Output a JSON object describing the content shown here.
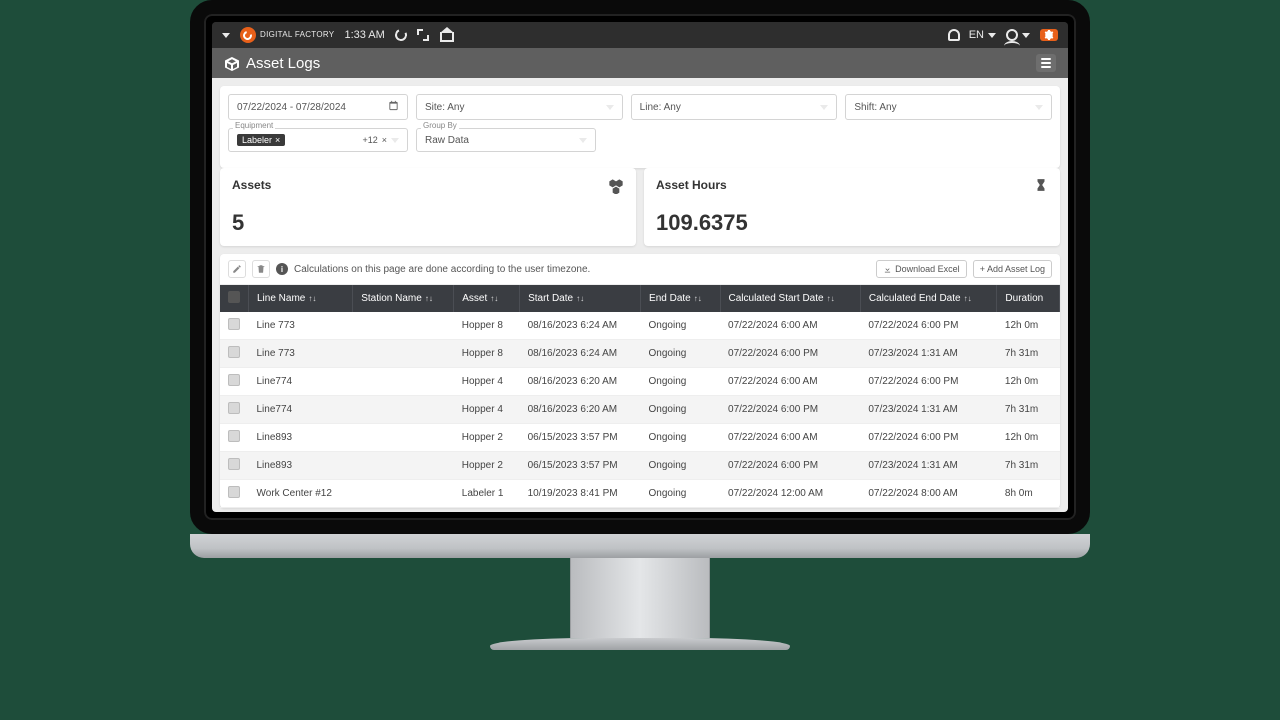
{
  "topbar": {
    "brand": "DIGITAL FACTORY",
    "time": "1:33 AM",
    "lang": "EN",
    "notif_badge": ""
  },
  "header": {
    "title": "Asset Logs"
  },
  "filters": {
    "date_range": "07/22/2024 - 07/28/2024",
    "site_label": "Site: Any",
    "line_label": "Line: Any",
    "shift_label": "Shift: Any",
    "equipment_label": "Equipment",
    "equipment_chip": "Labeler",
    "equipment_extra": "+12",
    "groupby_label": "Group By",
    "groupby_value": "Raw Data"
  },
  "stats": {
    "assets_label": "Assets",
    "assets_value": "5",
    "hours_label": "Asset Hours",
    "hours_value": "109.6375"
  },
  "toolbar": {
    "calc_info": "Calculations on this page are done according to the user timezone.",
    "download": "Download Excel",
    "add_log": "+ Add Asset Log"
  },
  "table": {
    "columns": [
      "Line Name",
      "Station Name",
      "Asset",
      "Start Date",
      "End Date",
      "Calculated Start Date",
      "Calculated End Date",
      "Duration"
    ],
    "rows": [
      {
        "line": "Line 773",
        "station": "",
        "asset": "Hopper 8",
        "start": "08/16/2023 6:24 AM",
        "end": "Ongoing",
        "calc_start": "07/22/2024 6:00 AM",
        "calc_end": "07/22/2024 6:00 PM",
        "dur": "12h 0m"
      },
      {
        "line": "Line 773",
        "station": "",
        "asset": "Hopper 8",
        "start": "08/16/2023 6:24 AM",
        "end": "Ongoing",
        "calc_start": "07/22/2024 6:00 PM",
        "calc_end": "07/23/2024 1:31 AM",
        "dur": "7h 31m"
      },
      {
        "line": "Line774",
        "station": "",
        "asset": "Hopper 4",
        "start": "08/16/2023 6:20 AM",
        "end": "Ongoing",
        "calc_start": "07/22/2024 6:00 AM",
        "calc_end": "07/22/2024 6:00 PM",
        "dur": "12h 0m"
      },
      {
        "line": "Line774",
        "station": "",
        "asset": "Hopper 4",
        "start": "08/16/2023 6:20 AM",
        "end": "Ongoing",
        "calc_start": "07/22/2024 6:00 PM",
        "calc_end": "07/23/2024 1:31 AM",
        "dur": "7h 31m"
      },
      {
        "line": "Line893",
        "station": "",
        "asset": "Hopper 2",
        "start": "06/15/2023 3:57 PM",
        "end": "Ongoing",
        "calc_start": "07/22/2024 6:00 AM",
        "calc_end": "07/22/2024 6:00 PM",
        "dur": "12h 0m"
      },
      {
        "line": "Line893",
        "station": "",
        "asset": "Hopper 2",
        "start": "06/15/2023 3:57 PM",
        "end": "Ongoing",
        "calc_start": "07/22/2024 6:00 PM",
        "calc_end": "07/23/2024 1:31 AM",
        "dur": "7h 31m"
      },
      {
        "line": "Work Center #12",
        "station": "",
        "asset": "Labeler 1",
        "start": "10/19/2023 8:41 PM",
        "end": "Ongoing",
        "calc_start": "07/22/2024 12:00 AM",
        "calc_end": "07/22/2024 8:00 AM",
        "dur": "8h 0m"
      }
    ]
  }
}
